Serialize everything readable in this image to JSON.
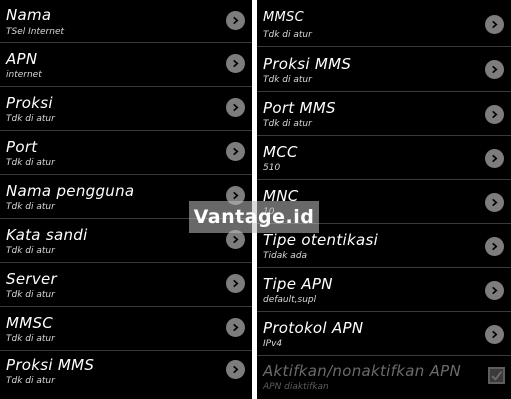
{
  "left_list": {
    "items": [
      {
        "title": "Nama",
        "summary": "TSel Internet"
      },
      {
        "title": "APN",
        "summary": "internet"
      },
      {
        "title": "Proksi",
        "summary": "Tdk di atur"
      },
      {
        "title": "Port",
        "summary": "Tdk di atur"
      },
      {
        "title": "Nama pengguna",
        "summary": "Tdk di atur"
      },
      {
        "title": "Kata sandi",
        "summary": "Tdk di atur"
      },
      {
        "title": "Server",
        "summary": "Tdk di atur"
      },
      {
        "title": "MMSC",
        "summary": "Tdk di atur"
      },
      {
        "title": "Proksi MMS",
        "summary": "Tdk di atur"
      }
    ]
  },
  "right_list": {
    "items": [
      {
        "title": "MMSC",
        "summary": "Tdk di atur"
      },
      {
        "title": "Proksi MMS",
        "summary": "Tdk di atur"
      },
      {
        "title": "Port MMS",
        "summary": "Tdk di atur"
      },
      {
        "title": "MCC",
        "summary": "510"
      },
      {
        "title": "MNC",
        "summary": "10"
      },
      {
        "title": "Tipe otentikasi",
        "summary": "Tidak ada"
      },
      {
        "title": "Tipe APN",
        "summary": "default,supl"
      },
      {
        "title": "Protokol APN",
        "summary": "IPv4"
      }
    ],
    "toggle": {
      "title": "Aktifkan/nonaktifkan APN",
      "summary": "APN diaktifkan",
      "checked": true
    }
  },
  "watermark": "Vantage.id",
  "icons": {
    "row_arrow": "chevron-right-icon",
    "toggle": "checkmark-icon"
  },
  "colors": {
    "background": "#000000",
    "arrow_circle": "#7d7d7d",
    "divider": "#ffffff"
  }
}
